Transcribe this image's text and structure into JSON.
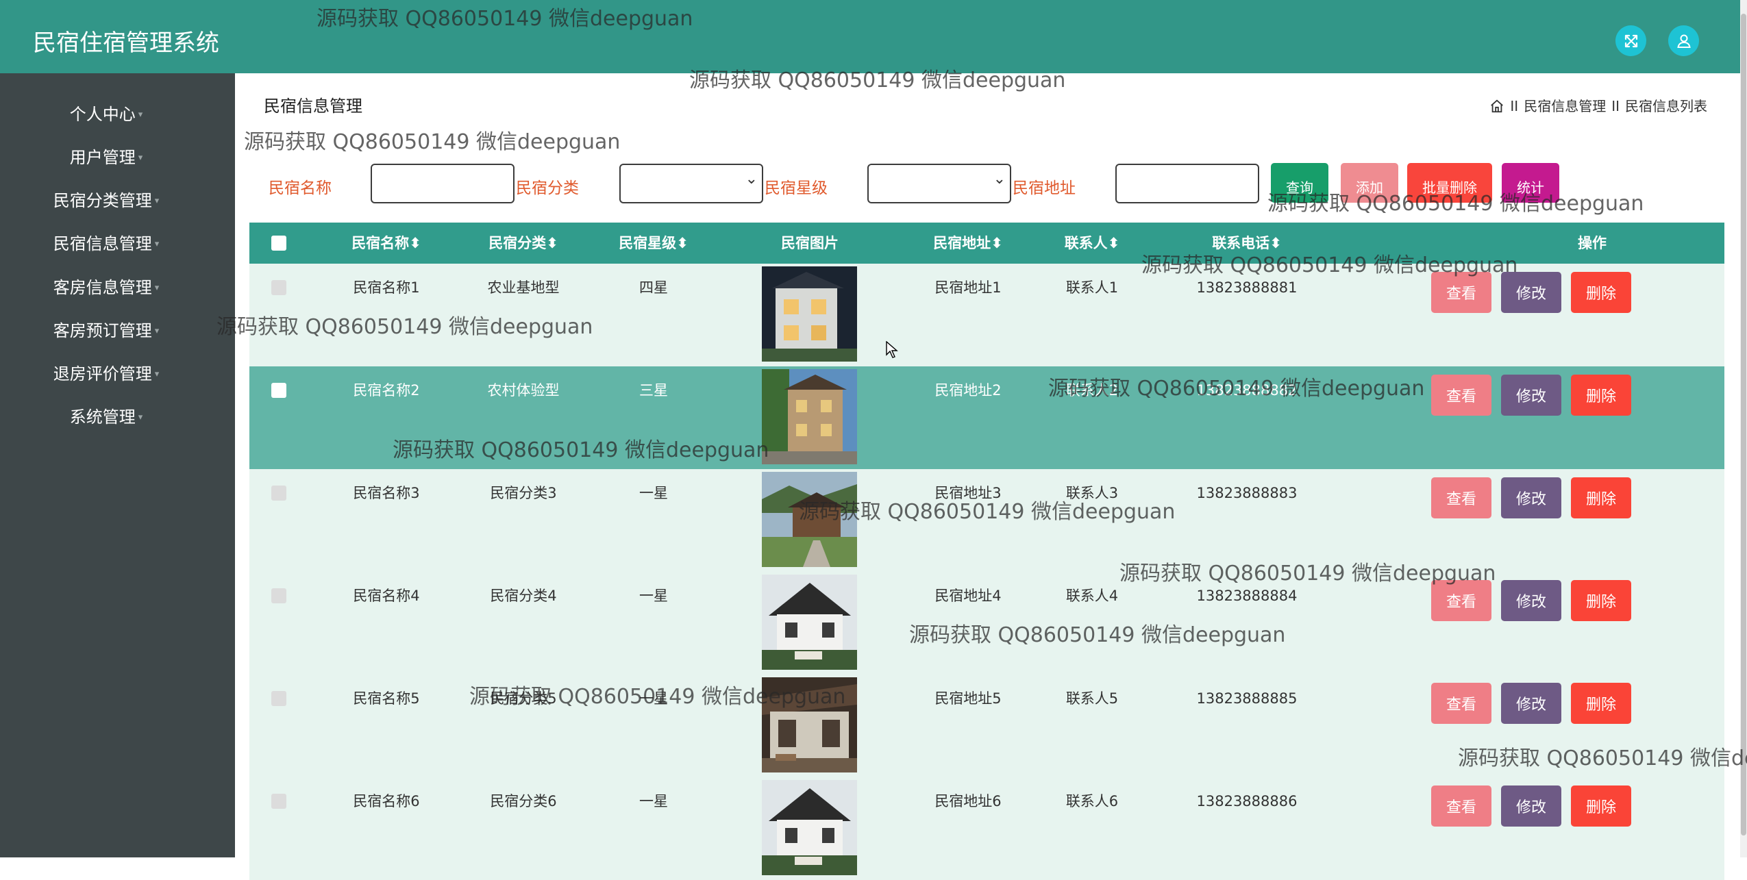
{
  "app_title": "民宿住宿管理系统",
  "sidebar": {
    "items": [
      {
        "label": "个人中心"
      },
      {
        "label": "用户管理"
      },
      {
        "label": "民宿分类管理"
      },
      {
        "label": "民宿信息管理"
      },
      {
        "label": "客房信息管理"
      },
      {
        "label": "客房预订管理"
      },
      {
        "label": "退房评价管理"
      },
      {
        "label": "系统管理"
      }
    ]
  },
  "page_title": "民宿信息管理",
  "breadcrumb": {
    "separator": "II",
    "items": [
      "民宿信息管理",
      "民宿信息列表"
    ]
  },
  "search": {
    "name_label": "民宿名称",
    "category_label": "民宿分类",
    "star_label": "民宿星级",
    "address_label": "民宿地址",
    "name_value": "",
    "category_value": "",
    "star_value": "",
    "address_value": ""
  },
  "buttons": {
    "query": "查询",
    "add": "添加",
    "batch_delete": "批量删除",
    "stats": "统计"
  },
  "table": {
    "columns": [
      "民宿名称",
      "民宿分类",
      "民宿星级",
      "民宿图片",
      "民宿地址",
      "联系人",
      "联系电话",
      "操作"
    ],
    "sort_icon": "⬍",
    "rows": [
      {
        "name": "民宿名称1",
        "category": "农业基地型",
        "star": "四星",
        "address": "民宿地址1",
        "contact": "联系人1",
        "phone": "13823888881"
      },
      {
        "name": "民宿名称2",
        "category": "农村体验型",
        "star": "三星",
        "address": "民宿地址2",
        "contact": "联系人2",
        "phone": "13823888882"
      },
      {
        "name": "民宿名称3",
        "category": "民宿分类3",
        "star": "一星",
        "address": "民宿地址3",
        "contact": "联系人3",
        "phone": "13823888883"
      },
      {
        "name": "民宿名称4",
        "category": "民宿分类4",
        "star": "一星",
        "address": "民宿地址4",
        "contact": "联系人4",
        "phone": "13823888884"
      },
      {
        "name": "民宿名称5",
        "category": "民宿分类5",
        "star": "一星",
        "address": "民宿地址5",
        "contact": "联系人5",
        "phone": "13823888885"
      },
      {
        "name": "民宿名称6",
        "category": "民宿分类6",
        "star": "一星",
        "address": "民宿地址6",
        "contact": "联系人6",
        "phone": "13823888886"
      }
    ],
    "actions": {
      "view": "查看",
      "edit": "修改",
      "delete": "删除"
    }
  },
  "watermark": "源码获取 QQ86050149 微信deepguan",
  "colors": {
    "header": "#329688",
    "sidebar": "#3e4749",
    "table_header": "#319c8c",
    "row_light": "#e7f4ef",
    "row_highlight": "#62b5a7",
    "search_label": "#e05a2d",
    "btn_query": "#179e6a",
    "btn_add": "#ef8c91",
    "btn_batch_delete": "#f9453c",
    "btn_stats": "#c41a8f",
    "btn_view": "#ef7e86",
    "btn_edit": "#6e5a85",
    "btn_delete": "#fa4437",
    "header_icon_bg": "#1ec3d4"
  }
}
